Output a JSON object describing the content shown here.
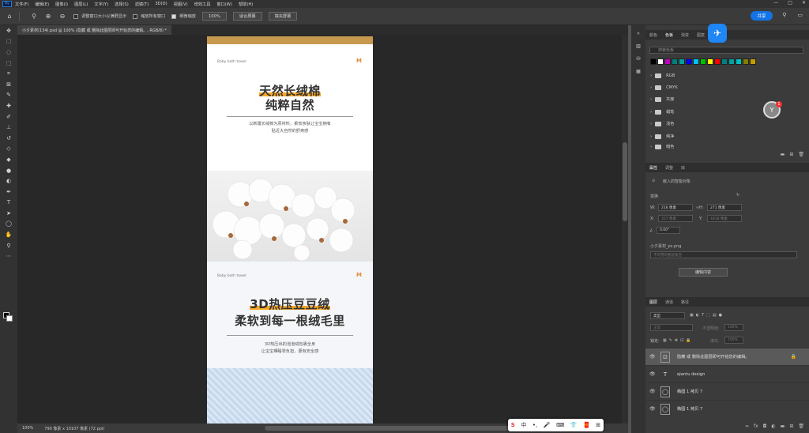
{
  "menu": [
    "文件(F)",
    "编辑(E)",
    "图像(I)",
    "图层(L)",
    "文字(Y)",
    "选择(S)",
    "滤镜(T)",
    "3D(D)",
    "视图(V)",
    "增效工具",
    "窗口(W)",
    "帮助(H)"
  ],
  "window_controls": [
    "—",
    "□",
    "✕"
  ],
  "options": {
    "resize_windows": "调整窗口大小以满屏显示",
    "zoom_all": "缩放所有窗口",
    "scrubby_zoom": "细微缩放",
    "zoom_value": "100%",
    "fit_screen": "适合屏幕",
    "fill_screen": "填充屏幕",
    "share": "共享"
  },
  "document_tab": "小夕素材(134).psd @ 100% (隐藏 或 删除此图层即可开始您的编辑。, RGB/8) *",
  "status": {
    "zoom": "100%",
    "info": "790 像素 x 10107 像素 (72 ppi)"
  },
  "canvas": {
    "brand1": "Baby bath towel",
    "mark": "M",
    "title1a": "天然长绒棉",
    "title1b": "纯粹自然",
    "desc1a": "以新疆长绒棉为原材料，柔软亲肤让宝宝拥有",
    "desc1b": "贴近大自然的舒爽感",
    "brand2": "Baby bath towel",
    "title2a": "3D热压豆豆绒",
    "title2b": "柔软到每一根绒毛里",
    "desc2a": "3D热压出的泡泡绒包裹全身",
    "desc2b": "让宝宝裸睡零负担，更有安全感"
  },
  "swatches_panel": {
    "tabs": [
      "颜色",
      "色板",
      "渐变",
      "图案"
    ],
    "search": "搜索色板",
    "colors": [
      "#000000",
      "#ffffff",
      "#c000c0",
      "#008080",
      "#00a0a0",
      "#0000ff",
      "#00c0ff",
      "#00c000",
      "#ffff00",
      "#ff0000",
      "#008080",
      "#00a0a0",
      "#00c0c0",
      "#808000",
      "#c0a000"
    ],
    "folders": [
      "RGB",
      "CMYK",
      "灰度",
      "蜡笔",
      "浅色",
      "纯净",
      "暗色"
    ]
  },
  "properties_panel": {
    "tabs": [
      "属性",
      "调整",
      "库"
    ],
    "embedded": "嵌入的智能对象",
    "transform": "变换",
    "w_label": "W:",
    "w_value": "216 像素",
    "h_label": "H:",
    "h_value": "271 像素",
    "x_label": "X:",
    "x_value": "357 像素",
    "y_label": "Y:",
    "y_value": "4918 像素",
    "angle_value": "0.00°",
    "filename": "小夕素材_ps.png",
    "comp": "不可用的图层复合",
    "edit_contents": "编辑内容"
  },
  "layers_panel": {
    "tabs": [
      "图层",
      "通道",
      "路径"
    ],
    "filter": "类型",
    "blend": "正常",
    "opacity_label": "不透明度:",
    "opacity": "100%",
    "lock_label": "锁定:",
    "fill_label": "填充:",
    "fill": "100%",
    "layers": [
      {
        "name": "隐藏 或 删除此图层即可开始您的编辑。",
        "kind": "smart"
      },
      {
        "name": "qiantu design",
        "kind": "text"
      },
      {
        "name": "椭圆 1 拷贝 7",
        "kind": "shape"
      },
      {
        "name": "椭圆 1 拷贝 7",
        "kind": "shape"
      }
    ]
  },
  "ime": [
    "S",
    "中",
    "•,",
    "🎤",
    "⌨",
    "👕",
    "🧧",
    "⊞"
  ]
}
